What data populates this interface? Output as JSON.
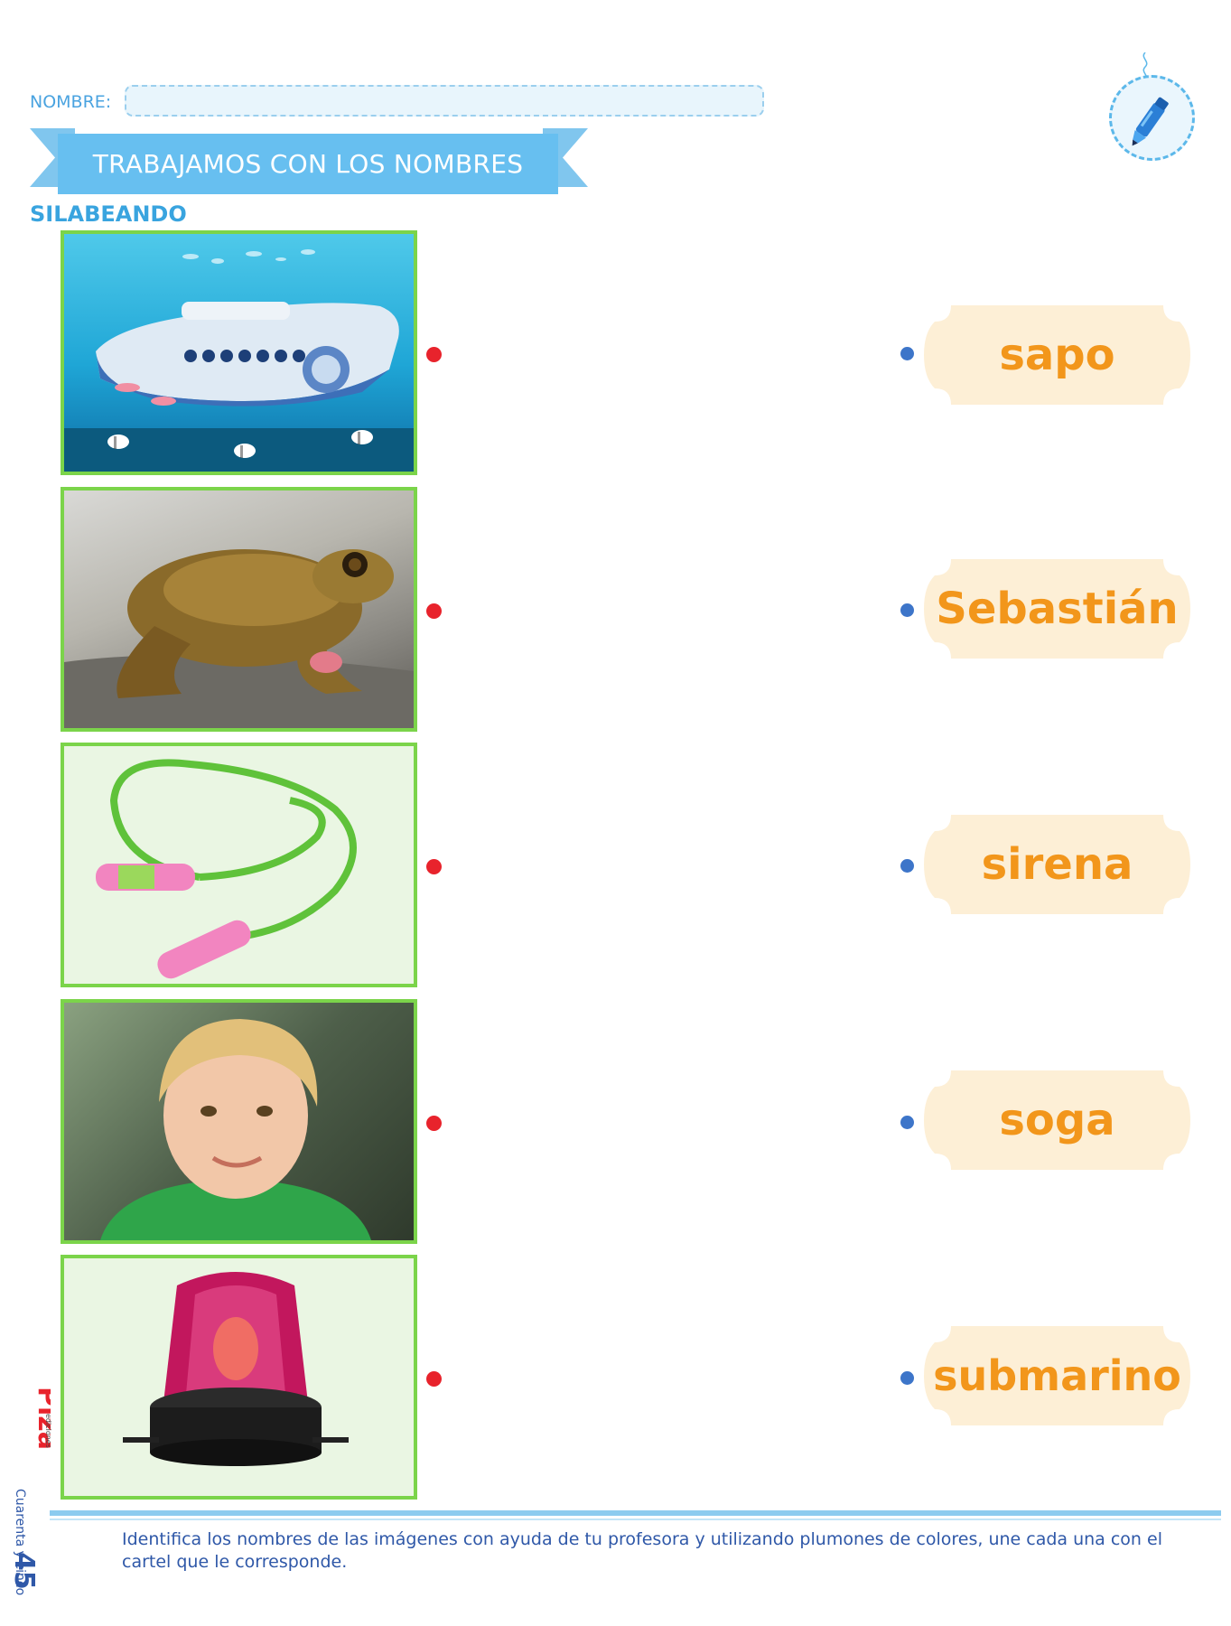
{
  "header": {
    "name_label": "NOMBRE:",
    "banner_title": "TRABAJAMOS CON LOS NOMBRES",
    "subtitle": "SILABEANDO",
    "badge_icon": "marker-icon"
  },
  "images": [
    {
      "name": "submarine-photo",
      "icon": "submarine"
    },
    {
      "name": "frog-photo",
      "icon": "frog"
    },
    {
      "name": "jump-rope-photo",
      "icon": "jump-rope"
    },
    {
      "name": "boy-photo",
      "icon": "child"
    },
    {
      "name": "siren-photo",
      "icon": "siren-light"
    }
  ],
  "words": [
    "sapo",
    "Sebastián",
    "sirena",
    "soga",
    "submarino"
  ],
  "footer": {
    "instruction": "Identifica los nombres de las imágenes con ayuda de tu profesora y utilizando plumones de colores, une cada una con el cartel que le corresponde.",
    "page_number": "45",
    "page_words": "Cuarenta y cinco",
    "logo_text": "Piza",
    "logo_subtext": "ediciones"
  },
  "colors": {
    "accent_blue": "#67bff0",
    "word_orange": "#f2961b",
    "plaque_fill": "#fdefd6",
    "photo_border": "#7bd44a",
    "dot_red": "#e8232c",
    "dot_blue": "#3d75c9"
  }
}
